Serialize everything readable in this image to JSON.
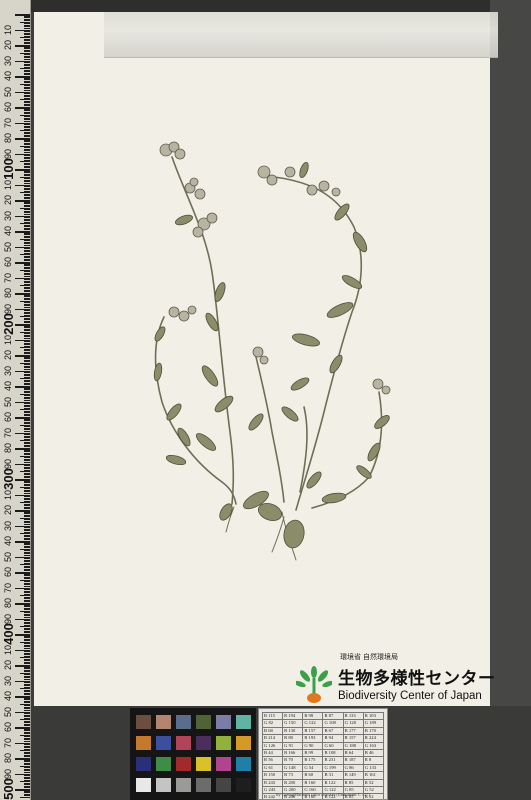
{
  "ruler": {
    "labels": [
      "10",
      "20",
      "30",
      "40",
      "50",
      "60",
      "70",
      "80",
      "90",
      "100",
      "10",
      "20",
      "30",
      "40",
      "50",
      "60",
      "70",
      "80",
      "90",
      "200",
      "10",
      "20",
      "30",
      "40",
      "50",
      "60",
      "70",
      "80",
      "90",
      "300",
      "10",
      "20",
      "30",
      "40",
      "50",
      "60",
      "70",
      "80",
      "90",
      "400",
      "10",
      "20",
      "30",
      "40",
      "50",
      "60",
      "70",
      "80",
      "90",
      "500"
    ]
  },
  "logo": {
    "ministry": "環境省 自然環境局",
    "name_jp": "生物多様性センター",
    "name_en": "Biodiversity Center of Japan"
  },
  "color_checker": {
    "patch_colors": [
      "#6b4e3f",
      "#b38570",
      "#5a6e8c",
      "#4f6336",
      "#7b7da6",
      "#5fb4a4",
      "#c47a2e",
      "#3c4f9c",
      "#b0455a",
      "#4a2f5a",
      "#93b03c",
      "#d49a28",
      "#2a2f7c",
      "#3e8c45",
      "#a32a2a",
      "#d8c228",
      "#b0458e",
      "#1f7fa6",
      "#e8e8e6",
      "#c4c4c2",
      "#9a9a98",
      "#6c6c6a",
      "#454543",
      "#1e1e1e"
    ]
  },
  "reference_card": {
    "rows": [
      [
        "R 115",
        "R 194",
        "R 98",
        "R 87",
        "R 133",
        "R 103"
      ],
      [
        "G 82",
        "G 150",
        "G 122",
        "G 108",
        "G 128",
        "G 189"
      ],
      [
        "B 68",
        "B 130",
        "B 157",
        "B 67",
        "B 177",
        "B 170"
      ],
      [
        "R 214",
        "R 80",
        "R 193",
        "R 94",
        "R 157",
        "R 224"
      ],
      [
        "G 126",
        "G 91",
        "G 90",
        "G 60",
        "G 188",
        "G 163"
      ],
      [
        "B 44",
        "B 166",
        "B 99",
        "B 108",
        "B 64",
        "B 46"
      ],
      [
        "R 56",
        "R 70",
        "R 175",
        "R 231",
        "R 187",
        "R 8"
      ],
      [
        "G 61",
        "G 148",
        "G 54",
        "G 199",
        "G 86",
        "G 133"
      ],
      [
        "B 150",
        "B 73",
        "B 60",
        "B 31",
        "B 149",
        "B 161"
      ],
      [
        "R 243",
        "R 200",
        "R 160",
        "R 122",
        "R 85",
        "R 52"
      ],
      [
        "G 243",
        "G 200",
        "G 160",
        "G 122",
        "G 85",
        "G 52"
      ],
      [
        "B 242",
        "B 200",
        "B 160",
        "B 122",
        "B 85",
        "B 52"
      ]
    ],
    "caption": "by GretagMacbeth color checker (Illuminant C / 2°)"
  },
  "specimen": {
    "description_icon": "pressed-plant-specimen"
  }
}
